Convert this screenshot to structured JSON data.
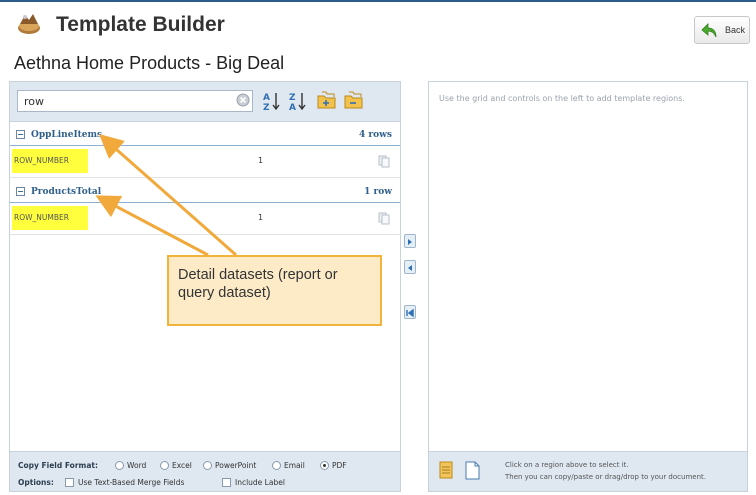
{
  "app": {
    "title": "Template Builder",
    "back_label": "Back"
  },
  "deal": {
    "title": "Aethna Home Products - Big Deal"
  },
  "search": {
    "value": "row"
  },
  "groups": [
    {
      "name": "OppLineItems",
      "count": "4 rows",
      "rows": [
        {
          "field": "ROW_NUMBER",
          "value": "1"
        }
      ]
    },
    {
      "name": "ProductsTotal",
      "count": "1 row",
      "rows": [
        {
          "field": "ROW_NUMBER",
          "value": "1"
        }
      ]
    }
  ],
  "footer": {
    "copy_format_label": "Copy Field Format:",
    "formats": [
      "Word",
      "Excel",
      "PowerPoint",
      "Email",
      "PDF"
    ],
    "selected_format": "PDF",
    "options_label": "Options:",
    "option_text_merge": "Use Text-Based Merge Fields",
    "option_include_label": "Include Label"
  },
  "right_panel": {
    "hint": "Use the grid and controls on the left to add template regions.",
    "footer_line1": "Click on a region above to select it.",
    "footer_line2": "Then you can copy/paste or drag/drop to your document."
  },
  "callout": {
    "text": "Detail datasets (report or query dataset)"
  },
  "colors": {
    "accent": "#2f5f8c",
    "highlight": "#ffff3d",
    "callout_bg": "#fdebc8",
    "callout_border": "#f2b33d",
    "arrow": "#f2a93b"
  },
  "icons": [
    "app-logo-icon",
    "back-arrow-icon",
    "clear-search-icon",
    "sort-ascending-icon",
    "sort-descending-icon",
    "expand-folders-icon",
    "collapse-folders-icon",
    "copy-icon",
    "move-right-icon",
    "move-left-icon",
    "move-first-icon",
    "document-icon",
    "new-page-icon"
  ]
}
